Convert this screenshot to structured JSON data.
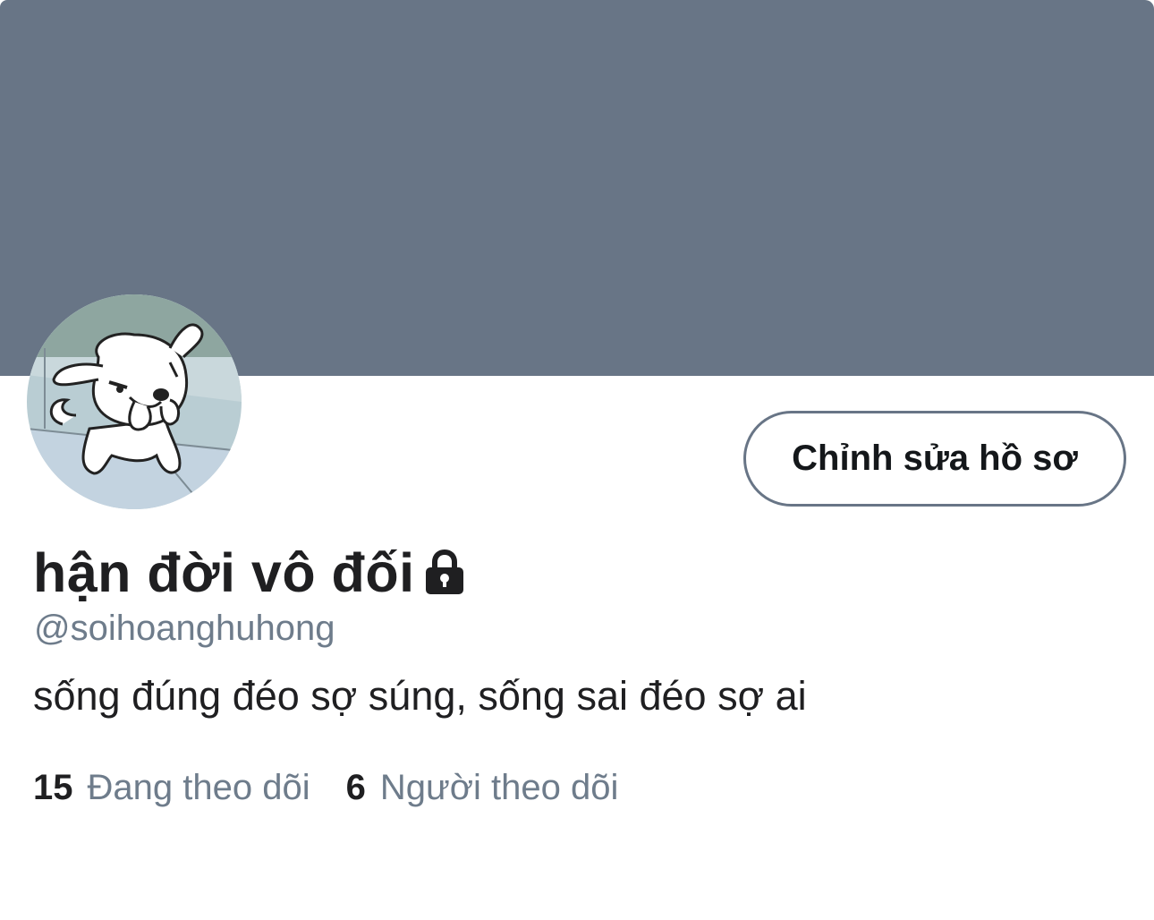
{
  "profile": {
    "display_name": "hận đời vô đối",
    "handle": "@soihoanghuhong",
    "bio": "sống đúng đéo sợ súng, sống sai đéo sợ ai",
    "locked_icon": "lock-icon",
    "avatar_icon": "cartoon-dog-avatar"
  },
  "actions": {
    "edit_profile_label": "Chỉnh sửa hồ sơ"
  },
  "stats": {
    "following_count": "15",
    "following_label": "Đang theo dõi",
    "followers_count": "6",
    "followers_label": "Người theo dõi"
  },
  "colors": {
    "banner": "#687586",
    "text_primary": "#1f1f21",
    "text_secondary": "#6e7c8b",
    "button_border": "#687586"
  }
}
